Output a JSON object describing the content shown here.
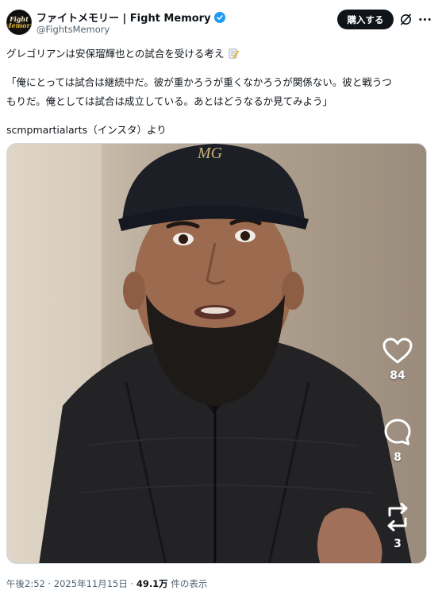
{
  "author": {
    "avatar_line1": "Fight",
    "avatar_line2": "Memory",
    "display_name": "ファイトメモリー | Fight Memory",
    "handle": "@FightsMemory"
  },
  "header": {
    "buy_label": "購入する"
  },
  "tweet": {
    "line1": "グレゴリアンは安保瑠輝也との試合を受ける考え",
    "line2": "「俺にとっては試合は継続中だ。彼が重かろうが重くなかろうが関係ない。彼と戦うつ",
    "line3": "もりだ。俺としては試合は成立している。あとはどうなるか見てみよう」",
    "line4": "scmpmartialarts（インスタ）より"
  },
  "media": {
    "cap_logo": "MG",
    "likes": "84",
    "comments": "8",
    "reposts": "3"
  },
  "meta": {
    "time": "午後2:52",
    "sep1": " · ",
    "date": "2025年11月15日",
    "sep2": " · ",
    "views": "49.1万",
    "views_suffix": " 件の表示"
  },
  "colors": {
    "accent": "#1d9bf0",
    "text": "#0f1419",
    "muted": "#536471"
  }
}
